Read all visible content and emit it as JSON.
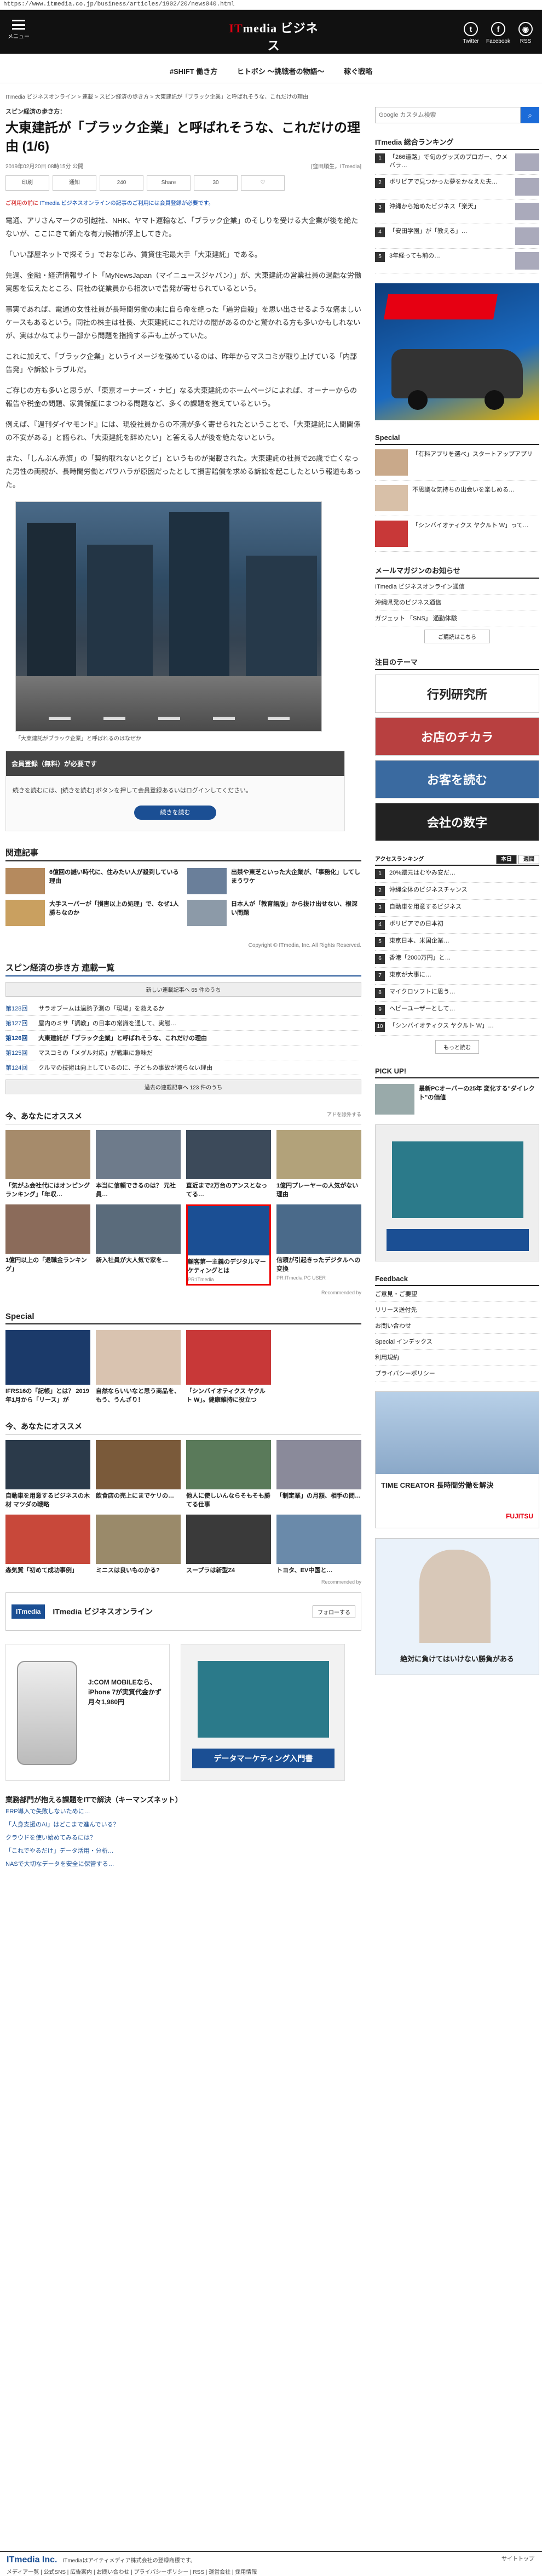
{
  "url": "https://www.itmedia.co.jp/business/articles/1902/20/news040.html",
  "header": {
    "menu_label": "メニュー",
    "logo_main_prefix": "IT",
    "logo_main_rest": "media ビジネス",
    "logo_sub": "ONLINE",
    "twitter_label": "Twitter",
    "facebook_label": "Facebook",
    "rss_label": "RSS"
  },
  "nav": {
    "items": [
      "#SHIFT 働き方",
      "ヒトボシ ～挑戦者の物語～",
      "稼ぐ戦略"
    ]
  },
  "breadcrumb": "ITmedia ビジネスオンライン > 連載 > スピン経済の歩き方 > 大東建託が「ブラック企業」と呼ばれそうな、これだけの理由",
  "article": {
    "series": "スピン経済の歩き方：",
    "title": "大東建託が「ブラック企業」と呼ばれそうな、これだけの理由 (1/6)",
    "date": "2019年02月20日 08時15分 公開",
    "author": "[窪田順生，ITmedia]",
    "share": {
      "print": "印刷",
      "tweet": "通知",
      "hatena": "240",
      "share": "Share",
      "fb": "30"
    },
    "notice_prefix": "ご利用の前に",
    "notice_rest": "ITmedia ビジネスオンラインの記事のご利用には会員登録が必要です。",
    "paragraphs": [
      "電通、アリさんマークの引越社、NHK、ヤマト運輸など、「ブラック企業」のそしりを受ける大企業が後を絶たないが、ここにきて新たな有力候補が浮上してきた。",
      "「いい部屋ネットで探そう」でおなじみ、賃貸住宅最大手「大東建託」である。",
      "先週、金融・経済情報サイト「MyNewsJapan（マイニュースジャパン）」が、大東建託の営業社員の過酷な労働実態を伝えたところ、同社の従業員から相次いで告発が寄せられているという。",
      "事実であれば、電通の女性社員が長時間労働の末に自ら命を絶った「過労自殺」を思い出させるような痛ましいケースもあるという。同社の株主は社長、大東建託にこれだけの闇があるのかと驚かれる方も多いかもしれないが、実はかねてより一部から問題を指摘する声も上がっていた。",
      "これに加えて、「ブラック企業」というイメージを強めているのは、昨年からマスコミが取り上げている「内部告発」や訴訟トラブルだ。",
      "ご存じの方も多いと思うが、「東京オーナーズ・ナビ」なる大東建託のホームページによれば、オーナーからの報告や税金の問題、家賃保証にまつわる問題など、多くの課題を抱えているという。",
      "例えば、『週刊ダイヤモンド』には、現役社員からの不満が多く寄せられたということで、「大東建託に人間関係の不安がある」と語られ、「大東建託を辞めたい」と答える人が後を絶たないという。",
      "また、「しんぶん赤旗」の「契約取れないとクビ」というものが掲載された。大東建託の社員で26歳で亡くなった男性の両親が、長時間労働とパワハラが原因だったとして損害賠償を求める訴訟を起こしたという報道もあった。"
    ],
    "photo_caption": "「大東建託がブラック企業」と呼ばれるのはなぜか",
    "member": {
      "badge": "会員登録（無料）が必要です",
      "text": "続きを読むには、[続きを読む] ボタンを押して会員登録あるいはログインしてください。",
      "button": "続きを読む"
    }
  },
  "related": {
    "heading": "関連記事",
    "items": [
      "6億回の謎い時代に、住みたい人が殺到している理由",
      "出禁や東芝といった大企業が、「事務化」してしまうワケ",
      "大手スーパーが「損害以上の処理」で、なぜ1人勝ちなのか",
      "日本人が「教育語版」から抜け出せない、根深い問題"
    ],
    "copyright": "Copyright © ITmedia, Inc. All Rights Reserved."
  },
  "series_list": {
    "heading": "スピン経済の歩き方 連載一覧",
    "new_btn": "新しい連載記事へ 65 件のうち",
    "items": [
      {
        "n": "第128回",
        "t": "サラオブームは過熱予測の「現場」を救えるか"
      },
      {
        "n": "第127回",
        "t": "屋内のミサ「調教」の日本の常識を通して、実態…"
      },
      {
        "n": "第126回",
        "t": "大東建託が「ブラック企業」と呼ばれそうな、これだけの理由"
      },
      {
        "n": "第125回",
        "t": "マスコミの「メダル対応」が戦車に意味だ"
      },
      {
        "n": "第124回",
        "t": "クルマの技術は向上しているのに、子どもの事故が減らない理由"
      }
    ],
    "old_btn": "過去の連載記事へ 123 件のうち"
  },
  "recommend": {
    "heading": "今、あなたにオススメ",
    "note": "アドを除外する",
    "items": [
      {
        "t": "「気がふ会社代にはオンピングランキング」「年収…",
        "pr": ""
      },
      {
        "t": "本当に信頼できるのは？ 元社員…",
        "pr": ""
      },
      {
        "t": "直近まで2万台のアンスとなってる…",
        "pr": ""
      },
      {
        "t": "1億円プレーヤーの人気がない理由",
        "pr": ""
      },
      {
        "t": "1億円以上の「退職金ランキング」",
        "pr": ""
      },
      {
        "t": "新入社員が大人気で家を…",
        "pr": ""
      },
      {
        "t": "顧客第一主義のデジタルマーケティングとは",
        "pr": "PR:ITmedia"
      },
      {
        "t": "信頼が引起きったデジタルへの変換",
        "pr": "PR:ITmedia PC USER"
      }
    ],
    "footnote": "Recommended by"
  },
  "special": {
    "heading": "Special",
    "items": [
      "IFRS16の「記帳」とは？ 2019年1月から「リース」が",
      "自然ならいいなと思う商品を、もう、うんざり！",
      "「シンバイオティクス ヤクルト W」。健康維持に役立つ",
      ""
    ]
  },
  "recommend2": {
    "heading": "今、あなたにオススメ",
    "items": [
      "自動車を用意するビジネスの木材 マツダの戦略",
      "飲食店の売上にまでケリの…",
      "他人に使しいんならそもそも勝てる仕事",
      "「制定業」の月額、相手の問…",
      "森気質「初めて成功事例」",
      "ミニスは良いものかる?",
      "スープラは新型Z4",
      "トヨタ、EV中国と…"
    ],
    "footnote": "Recommended by"
  },
  "yahoo": {
    "logo": "ITmedia",
    "name": "ITmedia ビジネスオンライン",
    "sub": "フォローする"
  },
  "ads": {
    "left_title": "J:COM MOBILEなら、iPhone 7が実質代金かず月々1,980円",
    "right_title": "データマーケティング入門書"
  },
  "keywords": {
    "heading": "業務部門が抱える課題をITで解決（キーマンズネット）",
    "items": [
      "ERP導入で失敗しないために…",
      "「人身支援のAI」はどこまで進んでいる？",
      "クラウドを使い始めてみるには？",
      "「これでやるだけ」データ活用・分析…",
      "NASで大切なデータを安全に保管する…"
    ]
  },
  "sidebar": {
    "search_placeholder": "Google カスタム検索",
    "ranking_heading": "ITmedia 総合ランキング",
    "ranking": [
      "「266道路」で旬のグッズのブロガー、ウメバラ…",
      "ボリビアで見つかった夢をかなえた夫…",
      "沖縄から始めたビジネス「楽天」",
      "「安田学園」が「教える」…",
      "3年経っても前の…"
    ],
    "special_heading": "Special",
    "special": [
      "「有料アプリを選べ」スタートアップアプリ",
      "不思議な気持ちの出会いを楽しめる…",
      "「シンバイオティクス ヤクルト W」って…"
    ],
    "mag_heading": "メールマガジンのお知らせ",
    "mag_items": [
      "ITmedia ビジネスオンライン通信",
      "沖縄県発のビジネス通信",
      "ガジェット 「SNS」 通勤体験"
    ],
    "mag_link": "ご購読はこちら",
    "tag_heading": "注目のテーマ",
    "tags": [
      "行列研究所",
      "お店のチカラ",
      "お客を読む",
      "会社の数字"
    ],
    "access_heading": "アクセスランキング",
    "tab_on": "本日",
    "tab_off": "週間",
    "access": [
      "20%還元はむやみ安だ…",
      "沖縄全体のビジネスチャンス",
      "自動車を用意するビジネス",
      "ボリビアでの日本初",
      "東京日本、米国企業…",
      "香港「2000万円」と…",
      "東京が大事に…",
      "マイクロソフトに思う…",
      "ヘビーユーザーとして…",
      "「シンバイオティクス ヤクルト W」…"
    ],
    "access_more": "もっと読む",
    "pickup_heading": "PICK UP!",
    "pickup_text": "最新PCオーバーの25年 変化する\"ダイレクト\"の価値",
    "feedback_heading": "Feedback",
    "feedback": [
      "ご意見・ご要望",
      "リリース送付先",
      "お問い合わせ",
      "Special インデックス",
      "利用規約",
      "プライバシーポリシー"
    ],
    "ad_timecreator": "TIME CREATOR 長時間労働を解決",
    "fujitsu": "FUJITSU",
    "bottom_text": "絶対に負けてはいけない勝負がある"
  },
  "footer": {
    "logo": "ITmedia Inc.",
    "company": "ITmediaはアイティメディア株式会社の登録商標です。",
    "links": "メディア一覧 | 公式SNS | 広告案内 | お問い合わせ | プライバシーポリシー | RSS | 運営会社 | 採用情報",
    "sitetop": "サイトトップ"
  }
}
